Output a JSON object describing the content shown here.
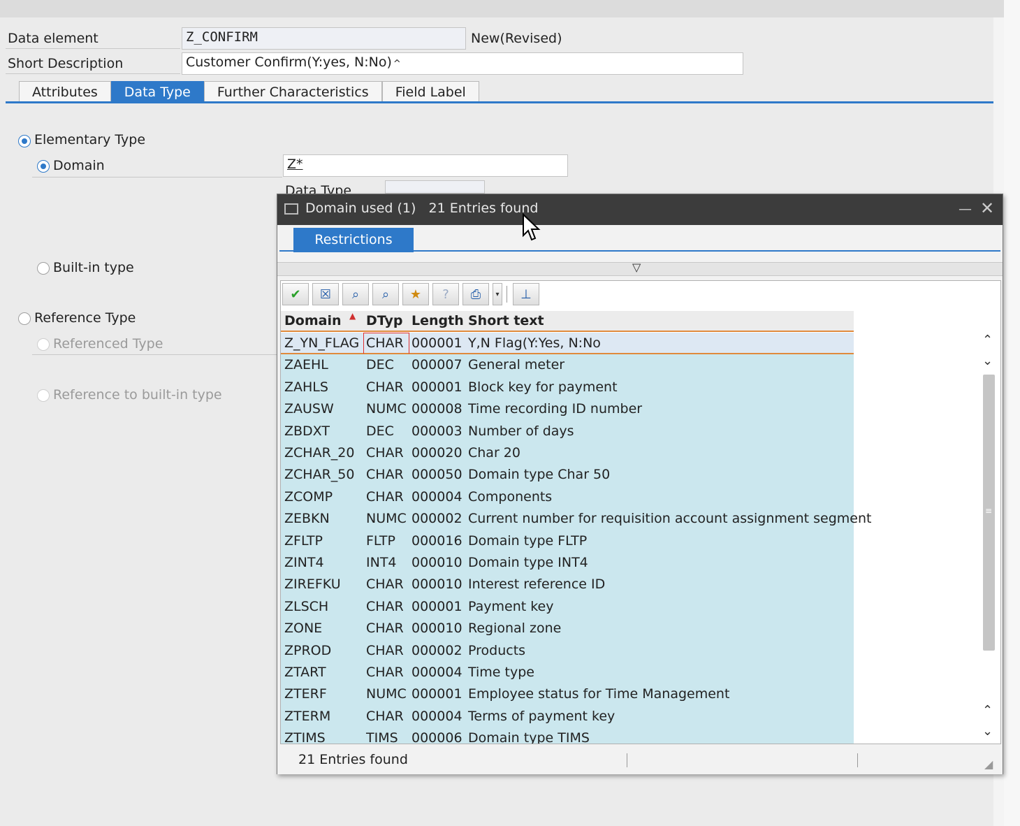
{
  "form": {
    "data_element_label": "Data element",
    "data_element_value": "Z_CONFIRM",
    "data_element_status": "New(Revised)",
    "short_desc_label": "Short Description",
    "short_desc_value": "Customer Confirm(Y:yes, N:No)"
  },
  "tabs": [
    "Attributes",
    "Data Type",
    "Further Characteristics",
    "Field Label"
  ],
  "active_tab": "Data Type",
  "type_section": {
    "elementary_label": "Elementary Type",
    "domain_label": "Domain",
    "domain_value": "Z*",
    "data_type_label": "Data Type",
    "builtin_label": "Built-in type",
    "reference_label": "Reference Type",
    "referenced_label": "Referenced Type",
    "ref_builtin_label": "Reference to built-in type"
  },
  "popup": {
    "title_prefix": "Domain used (1)",
    "title_count": "21 Entries found",
    "restrictions_tab": "Restrictions",
    "columns": [
      "Domain",
      "DTyp",
      "Length",
      "Short text"
    ],
    "rows": [
      [
        "Z_YN_FLAG",
        "CHAR",
        "000001",
        "Y,N Flag(Y:Yes, N:No"
      ],
      [
        "ZAEHL",
        "DEC",
        "000007",
        "General meter"
      ],
      [
        "ZAHLS",
        "CHAR",
        "000001",
        "Block key for payment"
      ],
      [
        "ZAUSW",
        "NUMC",
        "000008",
        "Time recording ID number"
      ],
      [
        "ZBDXT",
        "DEC",
        "000003",
        "Number of days"
      ],
      [
        "ZCHAR_20",
        "CHAR",
        "000020",
        "Char 20"
      ],
      [
        "ZCHAR_50",
        "CHAR",
        "000050",
        "Domain type Char 50"
      ],
      [
        "ZCOMP",
        "CHAR",
        "000004",
        "Components"
      ],
      [
        "ZEBKN",
        "NUMC",
        "000002",
        "Current number for requisition account assignment segment"
      ],
      [
        "ZFLTP",
        "FLTP",
        "000016",
        "Domain type FLTP"
      ],
      [
        "ZINT4",
        "INT4",
        "000010",
        "Domain type INT4"
      ],
      [
        "ZIREFKU",
        "CHAR",
        "000010",
        "Interest reference ID"
      ],
      [
        "ZLSCH",
        "CHAR",
        "000001",
        "Payment key"
      ],
      [
        "ZONE",
        "CHAR",
        "000010",
        "Regional zone"
      ],
      [
        "ZPROD",
        "CHAR",
        "000002",
        "Products"
      ],
      [
        "ZTART",
        "CHAR",
        "000004",
        "Time type"
      ],
      [
        "ZTERF",
        "NUMC",
        "000001",
        "Employee status for Time Management"
      ],
      [
        "ZTERM",
        "CHAR",
        "000004",
        "Terms of payment key"
      ],
      [
        "ZTIMS",
        "TIMS",
        "000006",
        "Domain type TIMS"
      ]
    ],
    "status_text": "21 Entries found"
  },
  "colors": {
    "accent": "#2e79c9",
    "row_bg": "#cbe7ee",
    "title_bar": "#3c3c3c",
    "sort_line": "#e08a3c"
  }
}
